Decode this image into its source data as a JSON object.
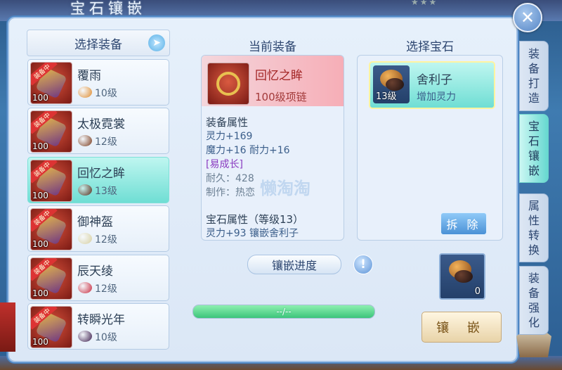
{
  "window": {
    "title": "宝石镶嵌",
    "close_label": "✕"
  },
  "left_panel": {
    "header": "选择装备",
    "items": [
      {
        "name": "覆雨",
        "level": "100",
        "tag": "装备中",
        "gem_level": "10级",
        "gem_color": "#e08a2a"
      },
      {
        "name": "太极霓裳",
        "level": "100",
        "tag": "装备中",
        "gem_level": "12级",
        "gem_color": "#7a3a1c"
      },
      {
        "name": "回忆之眸",
        "level": "100",
        "tag": "装备中",
        "gem_level": "13级",
        "gem_color": "#5a2a18",
        "active": true
      },
      {
        "name": "御神盔",
        "level": "100",
        "tag": "装备中",
        "gem_level": "12级",
        "gem_color": "#d8d0a0"
      },
      {
        "name": "辰天绫",
        "level": "100",
        "tag": "装备中",
        "gem_level": "12级",
        "gem_color": "#c8283c"
      },
      {
        "name": "转瞬光年",
        "level": "100",
        "tag": "装备中",
        "gem_level": "10级",
        "gem_color": "#3a1a4a"
      }
    ]
  },
  "center_panel": {
    "title": "当前装备",
    "equip_name": "回忆之眸",
    "equip_type": "100级项链",
    "attr_title": "装备属性",
    "attr_lines": [
      "灵力+169",
      "魔力+16 耐力+16"
    ],
    "special": "[易成长]",
    "durability": "耐久：428",
    "maker": "制作：热恋",
    "gem_attr_title": "宝石属性（等级13）",
    "gem_attr_line": "灵力+93 镶嵌舍利子",
    "progress_label": "镶嵌进度",
    "progress_text": "--/--",
    "progress_fraction": 1.0,
    "info_icon": "!"
  },
  "right_panel": {
    "title": "选择宝石",
    "gem": {
      "name": "舍利子",
      "level": "13级",
      "desc": "增加灵力"
    },
    "remove_label": "拆 除",
    "slot_count": "0",
    "inlay_label": "镶 嵌"
  },
  "side_tabs": [
    {
      "label": "装备打造",
      "chars": [
        "装",
        "备",
        "打",
        "造"
      ]
    },
    {
      "label": "宝石镶嵌",
      "chars": [
        "宝",
        "石",
        "镶",
        "嵌"
      ],
      "active": true
    },
    {
      "label": "属性转换",
      "chars": [
        "属",
        "性",
        "转",
        "换"
      ]
    },
    {
      "label": "装备强化",
      "chars": [
        "装",
        "备",
        "强",
        "化"
      ]
    }
  ],
  "watermark": "懒淘淘"
}
